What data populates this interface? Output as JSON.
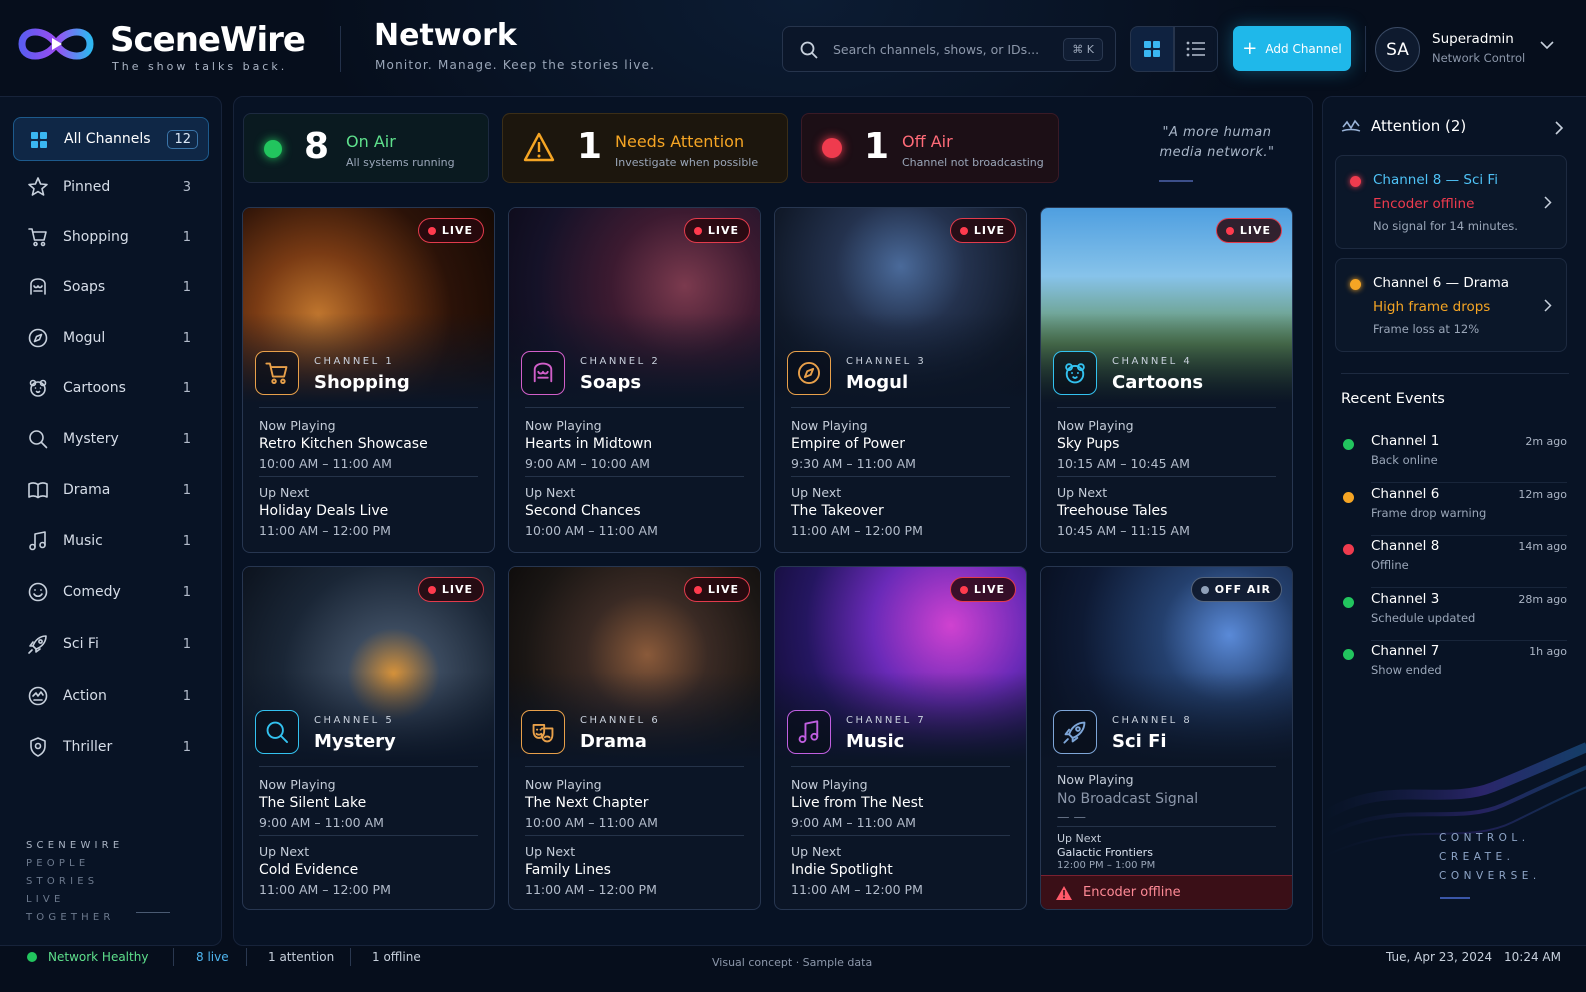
{
  "app": {
    "name": "SceneWire",
    "tagline": "The show talks back.",
    "trademark": "™"
  },
  "page": {
    "title": "Network",
    "subtitle": "Monitor. Manage. Keep the stories live."
  },
  "search": {
    "placeholder": "Search channels, shows, or IDs...",
    "shortcut": "⌘ K"
  },
  "toolbar": {
    "add_label": "Add Channel"
  },
  "user": {
    "initials": "SA",
    "name": "Superadmin",
    "role": "Network Control"
  },
  "sidebar": {
    "items": [
      {
        "label": "All Channels",
        "count": "12",
        "icon": "grid-icon"
      },
      {
        "label": "Pinned",
        "count": "3",
        "icon": "star-icon"
      },
      {
        "label": "Shopping",
        "count": "1",
        "icon": "cart-icon"
      },
      {
        "label": "Soaps",
        "count": "1",
        "icon": "soaps-icon"
      },
      {
        "label": "Mogul",
        "count": "1",
        "icon": "compass-icon"
      },
      {
        "label": "Cartoons",
        "count": "1",
        "icon": "bear-icon"
      },
      {
        "label": "Mystery",
        "count": "1",
        "icon": "search-icon"
      },
      {
        "label": "Drama",
        "count": "1",
        "icon": "book-icon"
      },
      {
        "label": "Music",
        "count": "1",
        "icon": "music-note-icon"
      },
      {
        "label": "Comedy",
        "count": "1",
        "icon": "smile-icon"
      },
      {
        "label": "Sci Fi",
        "count": "1",
        "icon": "rocket-icon"
      },
      {
        "label": "Action",
        "count": "1",
        "icon": "action-icon"
      },
      {
        "label": "Thriller",
        "count": "1",
        "icon": "shield-icon"
      }
    ],
    "brand_words": [
      "SCENEWIRE",
      "PEOPLE",
      "STORIES",
      "LIVE",
      "TOGETHER"
    ]
  },
  "stats": {
    "on_air": {
      "count": "8",
      "label": "On Air",
      "sub": "All systems running",
      "color": "#22c55e"
    },
    "attention": {
      "count": "1",
      "label": "Needs Attention",
      "sub": "Investigate when possible",
      "color": "#f5a524"
    },
    "off_air": {
      "count": "1",
      "label": "Off Air",
      "sub": "Channel not broadcasting",
      "color": "#ef3b4e"
    }
  },
  "quote": "\"A more human media network.\"",
  "labels": {
    "now_playing": "Now Playing",
    "up_next": "Up Next",
    "live": "LIVE",
    "off_air": "OFF AIR"
  },
  "channels": [
    {
      "num": "CHANNEL 1",
      "name": "Shopping",
      "now_title": "Retro Kitchen Showcase",
      "now_time": "10:00 AM – 11:00 AM",
      "next_title": "Holiday Deals Live",
      "next_time": "11:00 AM – 12:00 PM",
      "status": "live",
      "accent": "#e8a04a",
      "icon": "cart-icon"
    },
    {
      "num": "CHANNEL 2",
      "name": "Soaps",
      "now_title": "Hearts in Midtown",
      "now_time": "9:00 AM – 10:00 AM",
      "next_title": "Second Chances",
      "next_time": "10:00 AM – 11:00 AM",
      "status": "live",
      "accent": "#d15fc9",
      "icon": "soaps-icon"
    },
    {
      "num": "CHANNEL 3",
      "name": "Mogul",
      "now_title": "Empire of Power",
      "now_time": "9:30 AM – 11:00 AM",
      "next_title": "The Takeover",
      "next_time": "11:00 AM – 12:00 PM",
      "status": "live",
      "accent": "#e8a04a",
      "icon": "compass-icon"
    },
    {
      "num": "CHANNEL 4",
      "name": "Cartoons",
      "now_title": "Sky Pups",
      "now_time": "10:15 AM – 10:45 AM",
      "next_title": "Treehouse Tales",
      "next_time": "10:45 AM – 11:15 AM",
      "status": "live",
      "accent": "#33c2f0",
      "icon": "bear-icon"
    },
    {
      "num": "CHANNEL 5",
      "name": "Mystery",
      "now_title": "The Silent Lake",
      "now_time": "9:00 AM – 11:00 AM",
      "next_title": "Cold Evidence",
      "next_time": "11:00 AM – 12:00 PM",
      "status": "live",
      "accent": "#33c2f0",
      "icon": "search-icon"
    },
    {
      "num": "CHANNEL 6",
      "name": "Drama",
      "now_title": "The Next Chapter",
      "now_time": "10:00 AM – 11:00 AM",
      "next_title": "Family Lines",
      "next_time": "11:00 AM – 12:00 PM",
      "status": "live",
      "accent": "#e8a04a",
      "icon": "masks-icon"
    },
    {
      "num": "CHANNEL 7",
      "name": "Music",
      "now_title": "Live from The Nest",
      "now_time": "9:00 AM – 11:00 AM",
      "next_title": "Indie Spotlight",
      "next_time": "11:00 AM – 12:00 PM",
      "status": "live",
      "accent": "#c05fe0",
      "icon": "music-note-icon"
    },
    {
      "num": "CHANNEL 8",
      "name": "Sci Fi",
      "now_title": "No Broadcast Signal",
      "now_time": "— —",
      "next_title": "Galactic Frontiers",
      "next_time": "12:00 PM – 1:00 PM",
      "status": "off",
      "accent": "#7ea6d8",
      "icon": "rocket-icon",
      "alert": "Encoder offline"
    }
  ],
  "attention": {
    "title": "Attention (2)",
    "items": [
      {
        "channel": "Channel 8 — Sci Fi",
        "issue": "Encoder offline",
        "detail": "No signal for 14 minutes.",
        "color": "#ef3b4e"
      },
      {
        "channel": "Channel 6 — Drama",
        "issue": "High frame drops",
        "detail": "Frame loss at 12%",
        "color": "#f5a524"
      }
    ]
  },
  "recent": {
    "title": "Recent Events",
    "items": [
      {
        "name": "Channel 1",
        "desc": "Back online",
        "time": "2m ago",
        "color": "#22c55e"
      },
      {
        "name": "Channel 6",
        "desc": "Frame drop warning",
        "time": "12m ago",
        "color": "#f5a524"
      },
      {
        "name": "Channel 8",
        "desc": "Offline",
        "time": "14m ago",
        "color": "#ef3b4e"
      },
      {
        "name": "Channel 3",
        "desc": "Schedule updated",
        "time": "28m ago",
        "color": "#22c55e"
      },
      {
        "name": "Channel 7",
        "desc": "Show ended",
        "time": "1h ago",
        "color": "#22c55e"
      }
    ],
    "words": [
      "CONTROL.",
      "CREATE.",
      "CONVERSE."
    ]
  },
  "footer": {
    "health": "Network Healthy",
    "live": "8 live",
    "attention": "1 attention",
    "offline": "1 offline",
    "note": "Visual concept · Sample data",
    "date": "Tue, Apr 23, 2024",
    "time": "10:24 AM"
  }
}
